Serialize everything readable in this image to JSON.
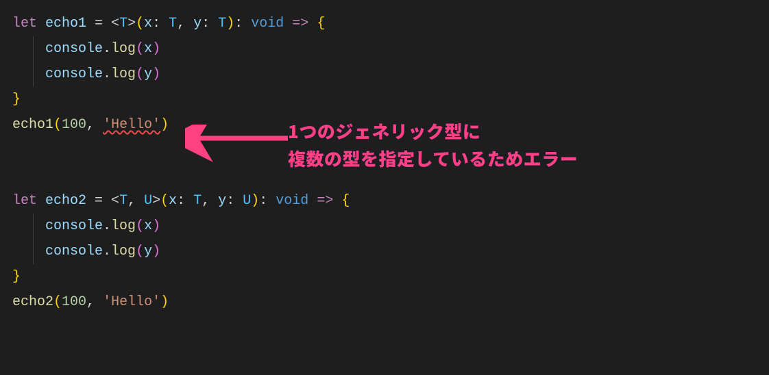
{
  "code": {
    "line1": {
      "let": "let",
      "name": "echo1",
      "eq": " = ",
      "T": "T",
      "x": "x",
      "y": "y",
      "void": "void"
    },
    "line2": {
      "console": "console",
      "log": "log",
      "arg": "x"
    },
    "line3": {
      "console": "console",
      "log": "log",
      "arg": "y"
    },
    "line4": {
      "brace": "}"
    },
    "line5": {
      "call": "echo1",
      "num": "100",
      "str": "'Hello'"
    },
    "line6": {
      "let": "let",
      "name": "echo2",
      "T": "T",
      "U": "U",
      "x": "x",
      "y": "y",
      "void": "void"
    },
    "line7": {
      "console": "console",
      "log": "log",
      "arg": "x"
    },
    "line8": {
      "console": "console",
      "log": "log",
      "arg": "y"
    },
    "line9": {
      "brace": "}"
    },
    "line10": {
      "call": "echo2",
      "num": "100",
      "str": "'Hello'"
    }
  },
  "annotation": {
    "line1": "1つのジェネリック型に",
    "line2": "複数の型を指定しているためエラー"
  },
  "colors": {
    "annotation": "#ff4081",
    "error_underline": "#f14c4c"
  }
}
